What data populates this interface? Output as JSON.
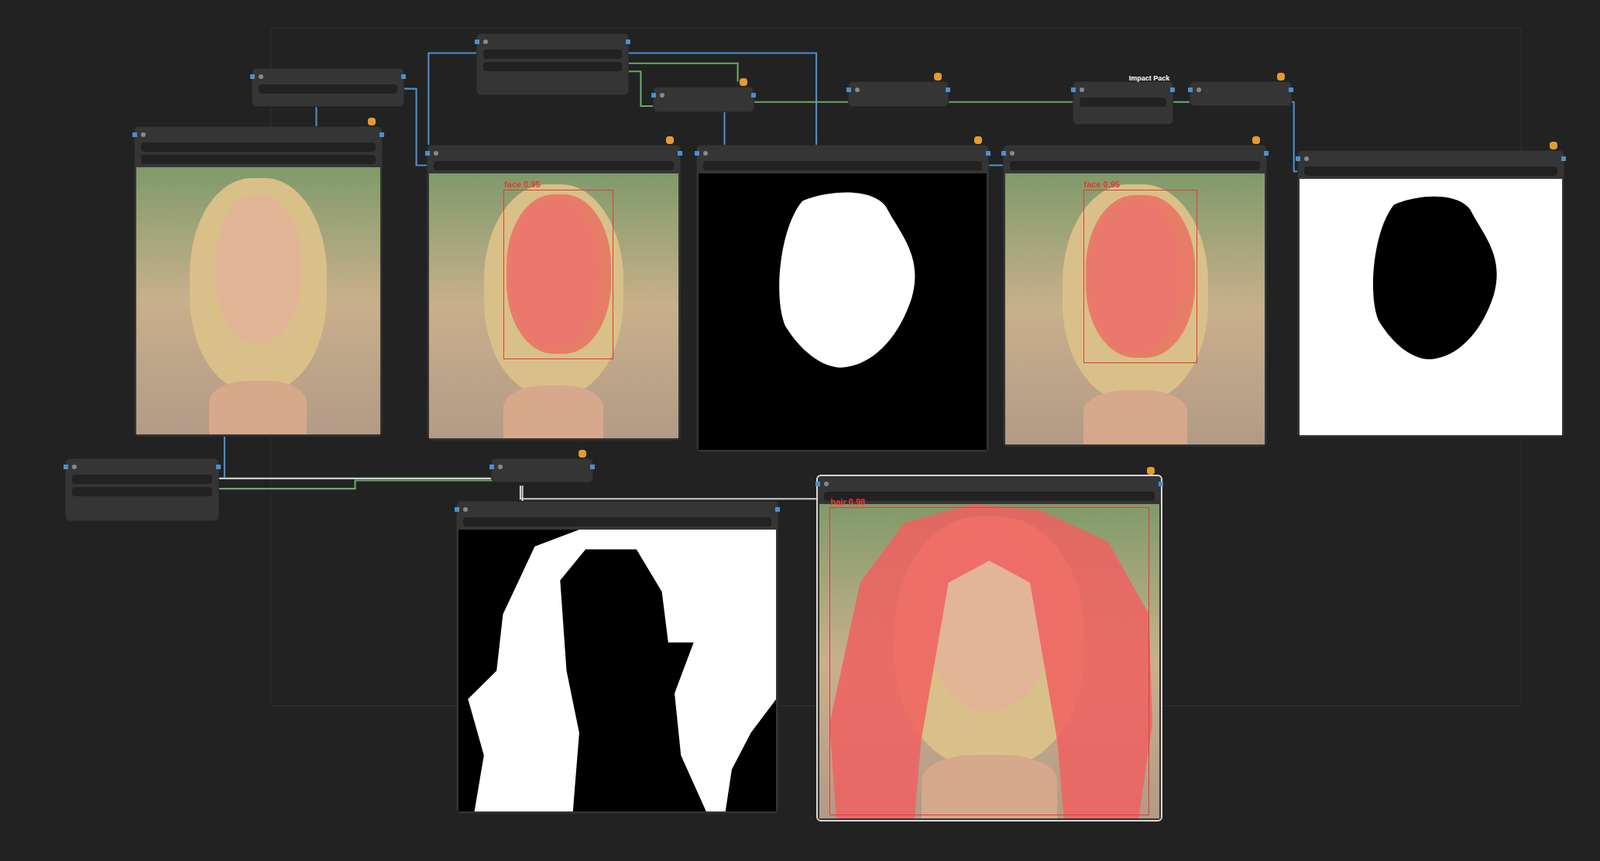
{
  "canvas": {
    "group": true
  },
  "nodes": [
    {
      "kind": "widget",
      "selected": false,
      "badge": ""
    },
    {
      "kind": "widget",
      "selected": false,
      "badge": ""
    },
    {
      "kind": "widget",
      "selected": false,
      "badge": ""
    },
    {
      "kind": "widget",
      "selected": false,
      "badge": ""
    },
    {
      "kind": "widget",
      "selected": false,
      "badge": "Impact Pack"
    },
    {
      "kind": "widget",
      "selected": false,
      "badge": ""
    },
    {
      "kind": "photo",
      "selected": false,
      "badge": ""
    },
    {
      "kind": "detect-face",
      "selected": false,
      "badge": "",
      "detection": {
        "label": "face 0.95",
        "color": "#e53935"
      }
    },
    {
      "kind": "mask",
      "selected": false,
      "badge": ""
    },
    {
      "kind": "detect-face",
      "selected": false,
      "badge": "",
      "detection": {
        "label": "face 0.95",
        "color": "#e53935"
      }
    },
    {
      "kind": "mask-inverted",
      "selected": false,
      "badge": ""
    },
    {
      "kind": "widget",
      "selected": false,
      "badge": ""
    },
    {
      "kind": "widget",
      "selected": false,
      "badge": ""
    },
    {
      "kind": "mask-hair",
      "selected": false,
      "badge": ""
    },
    {
      "kind": "detect-hair",
      "selected": true,
      "badge": "",
      "detection": {
        "label": "hair 0.98",
        "color": "#e53935"
      }
    }
  ]
}
